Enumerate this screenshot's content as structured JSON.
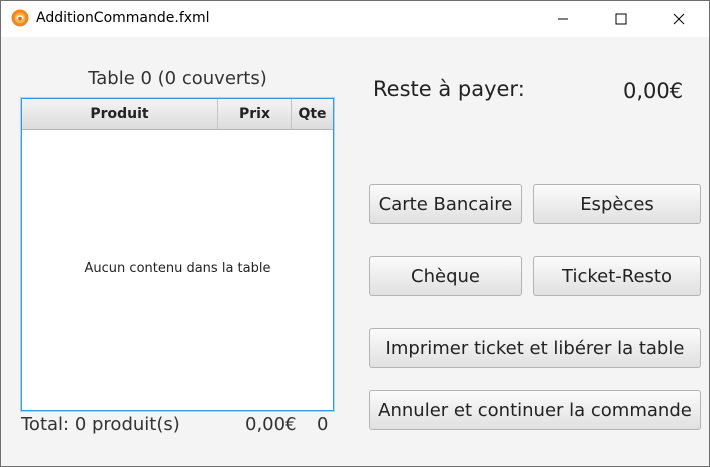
{
  "window": {
    "title": "AdditionCommande.fxml",
    "app_icon": "javafx-app-icon",
    "controls": [
      "minimize-icon",
      "maximize-icon",
      "close-icon"
    ]
  },
  "table": {
    "caption": "Table 0 (0 couverts)",
    "columns": [
      "Produit",
      "Prix",
      "Qte"
    ],
    "placeholder": "Aucun contenu dans la table"
  },
  "summary": {
    "total_label": "Total: 0 produit(s)",
    "total_price": "0,00€",
    "total_qty": "0"
  },
  "payment": {
    "reste_label": "Reste à payer:",
    "reste_value": "0,00€"
  },
  "buttons": {
    "carte": "Carte Bancaire",
    "especes": "Espèces",
    "cheque": "Chèque",
    "ticket": "Ticket-Resto",
    "imprimer": "Imprimer ticket et libérer la table",
    "annuler": "Annuler et continuer la commande"
  },
  "colors": {
    "accent_border": "#3c9ad8",
    "window_background": "#f4f4f4",
    "app_icon": "#e8892a"
  }
}
